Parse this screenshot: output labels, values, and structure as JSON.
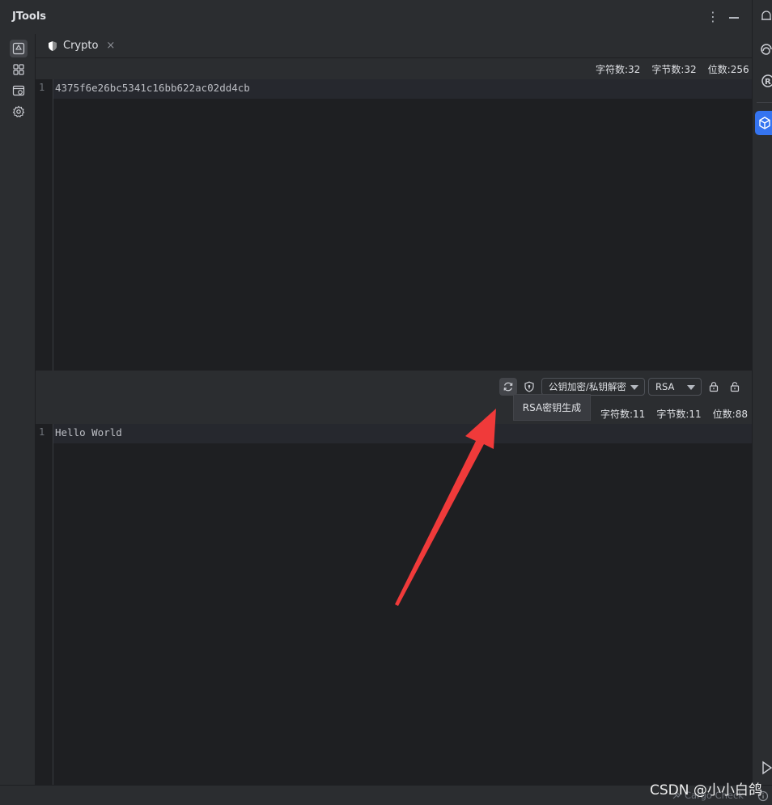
{
  "app": {
    "title": "JTools"
  },
  "tab": {
    "label": "Crypto",
    "close": "×"
  },
  "top_stats": {
    "chars": "字符数:32",
    "bytes": "字节数:32",
    "bits": "位数:256"
  },
  "top_editor": {
    "line_number": "1",
    "content": "4375f6e26bc5341c16bb622ac02dd4cb"
  },
  "toolbar": {
    "mode_select": "公钥加密/私钥解密",
    "algo_select": "RSA",
    "tooltip": "RSA密钥生成"
  },
  "bottom_stats": {
    "chars": "字符数:11",
    "bytes": "字节数:11",
    "bits": "位数:88"
  },
  "bottom_editor": {
    "line_number": "1",
    "content": "Hello World"
  },
  "status": {
    "cargo": "Cargo Check"
  },
  "watermark": "CSDN @小小白鸽",
  "colors": {
    "accent": "#3574f0",
    "arrow": "#f03a3a",
    "editor_bg": "#1e1f22",
    "panel_bg": "#2b2d30"
  }
}
